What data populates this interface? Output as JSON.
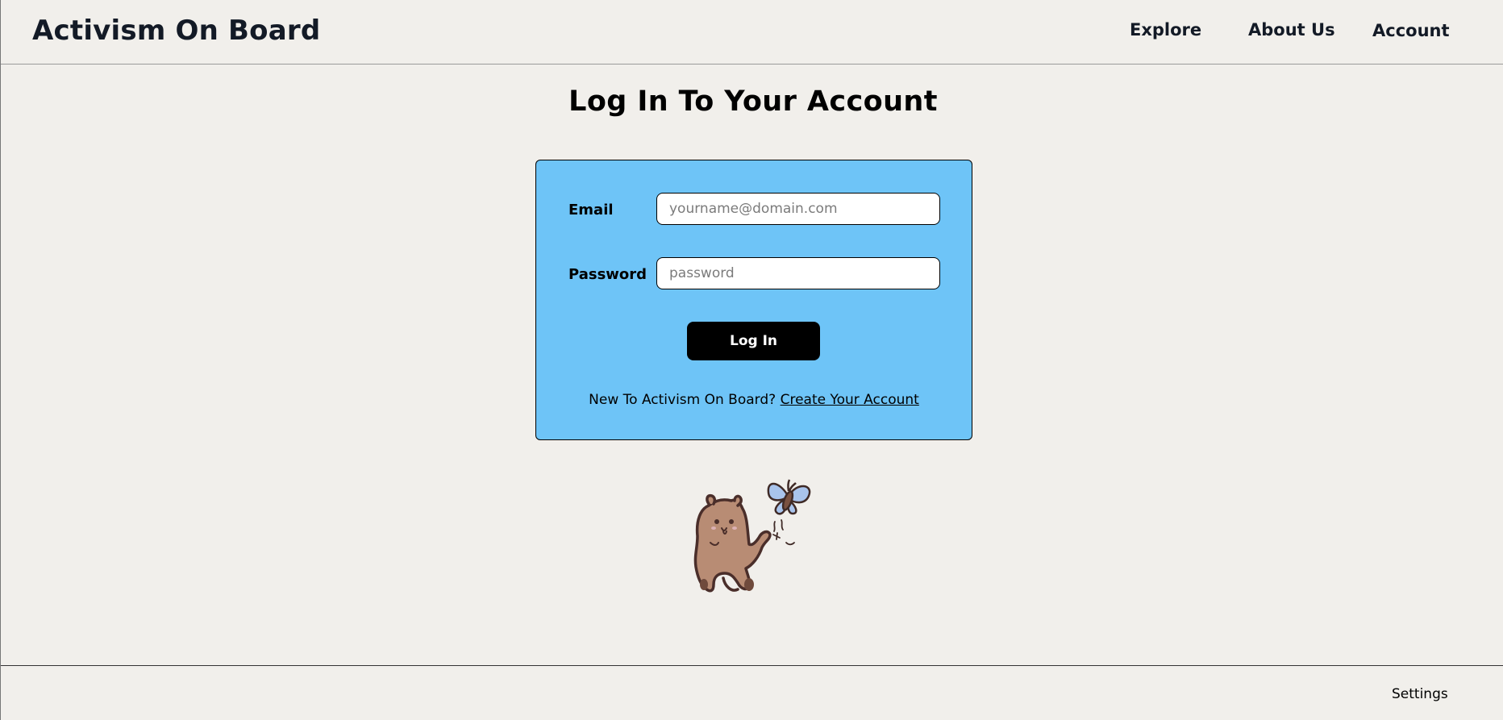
{
  "header": {
    "brand": "Activism On Board",
    "nav": {
      "explore": "Explore",
      "about": "About Us",
      "account": "Account"
    }
  },
  "main": {
    "title": "Log In To Your Account",
    "form": {
      "email_label": "Email",
      "email_placeholder": "yourname@domain.com",
      "email_value": "",
      "password_label": "Password",
      "password_placeholder": "password",
      "password_value": "",
      "submit_label": "Log In",
      "signup_prompt": "New To Activism On Board?",
      "signup_link": "Create Your Account"
    },
    "mascot": {
      "icon": "capybara-with-butterfly-illustration"
    }
  },
  "footer": {
    "settings": "Settings"
  },
  "colors": {
    "background": "#f1efeb",
    "card": "#6ec4f7",
    "button": "#000000",
    "button_text": "#ffffff",
    "heading": "#131a26"
  }
}
